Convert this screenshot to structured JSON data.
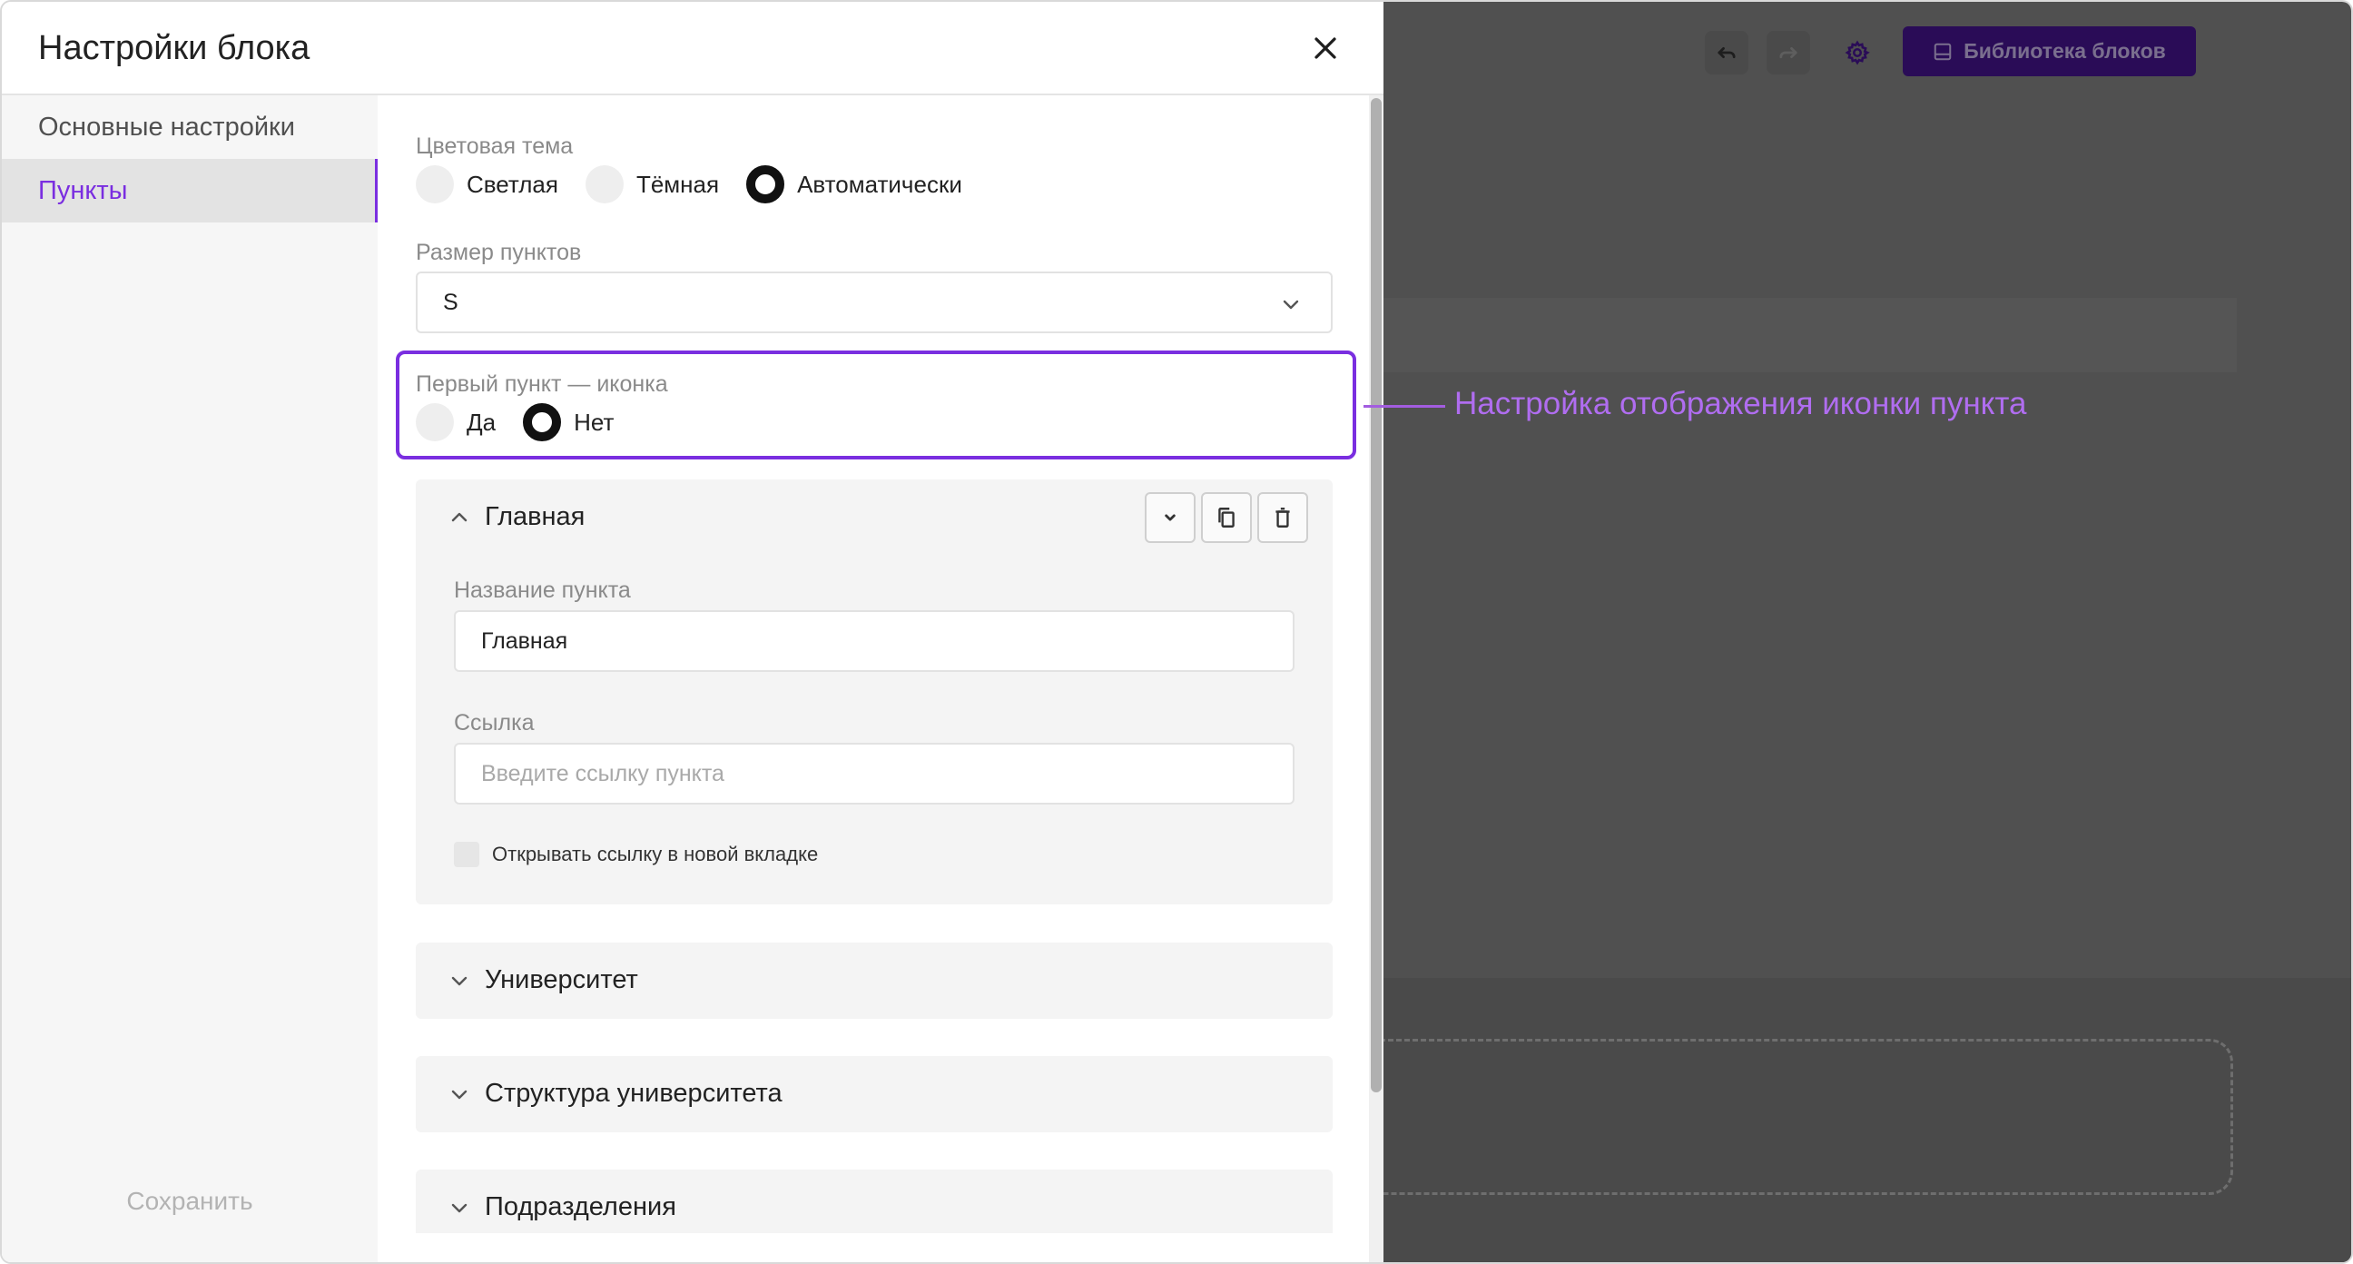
{
  "modal": {
    "title": "Настройки блока",
    "sidebar": {
      "items": [
        {
          "label": "Основные настройки",
          "active": false
        },
        {
          "label": "Пункты",
          "active": true
        }
      ],
      "save_label": "Сохранить"
    }
  },
  "form": {
    "color_theme": {
      "label": "Цветовая тема",
      "options": [
        "Светлая",
        "Тёмная",
        "Автоматически"
      ],
      "selected": "Автоматически"
    },
    "item_size": {
      "label": "Размер пунктов",
      "value": "S"
    },
    "first_item_icon": {
      "label": "Первый пункт — иконка",
      "options": [
        "Да",
        "Нет"
      ],
      "selected": "Нет"
    },
    "items": [
      {
        "title": "Главная",
        "expanded": true,
        "name_label": "Название пункта",
        "name_value": "Главная",
        "link_label": "Ссылка",
        "link_placeholder": "Введите ссылку пункта",
        "new_tab_label": "Открывать ссылку в новой вкладке",
        "new_tab_checked": false
      },
      {
        "title": "Университет",
        "expanded": false
      },
      {
        "title": "Структура университета",
        "expanded": false
      },
      {
        "title": "Подразделения",
        "expanded": false
      }
    ]
  },
  "editor": {
    "library_button_label": "Библиотека блоков",
    "icons": [
      "undo-icon",
      "redo-icon",
      "gear-icon",
      "library-icon"
    ]
  },
  "annotation": {
    "text": "Настройка отображения иконки пункта",
    "color": "#b06df0"
  },
  "colors": {
    "accent": "#7a2ee0",
    "library_button_bg": "#2a0c57",
    "backdrop": "#505050"
  }
}
